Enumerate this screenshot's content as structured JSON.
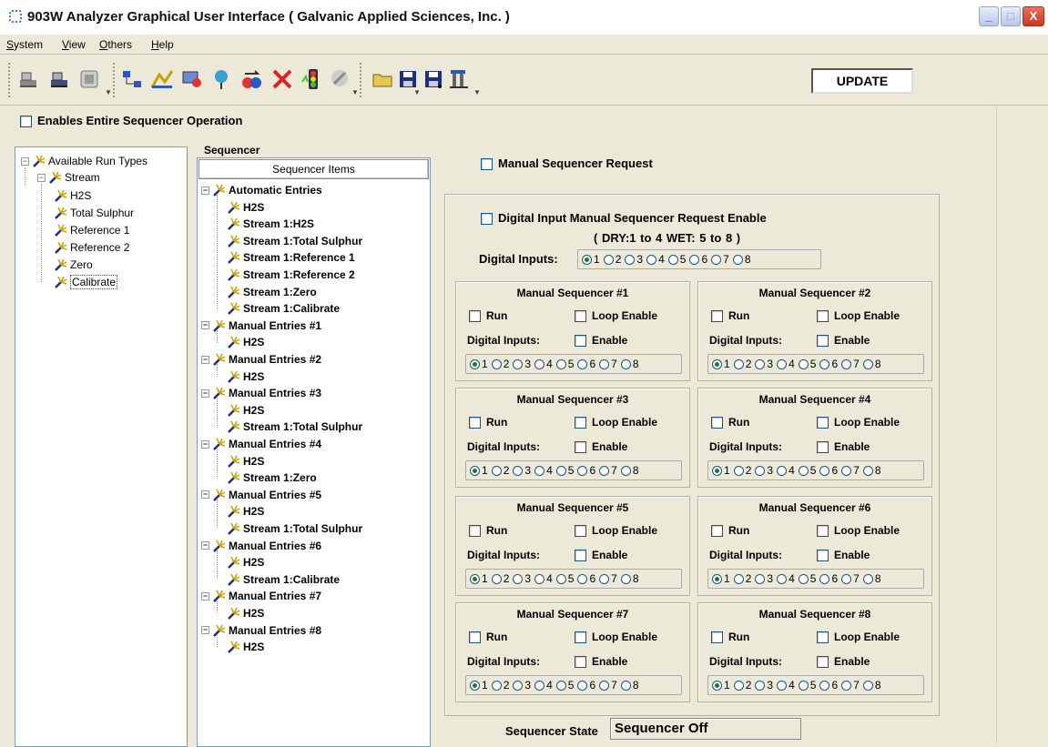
{
  "window": {
    "title": "903W Analyzer Graphical User Interface ( Galvanic Applied Sciences, Inc. )",
    "minimize": "_",
    "maximize": "□",
    "close": "X"
  },
  "menu": {
    "items": [
      "System",
      "View",
      "Others",
      "Help"
    ]
  },
  "toolbar": {
    "update_label": "UPDATE"
  },
  "enable_sequencer": "Enables Entire Sequencer Operation",
  "run_types": {
    "root": "Available Run Types",
    "stream": "Stream",
    "items": [
      "H2S",
      "Total Sulphur",
      "Reference 1",
      "Reference 2",
      "Zero",
      "Calibrate"
    ],
    "selected": "Calibrate"
  },
  "sequencer": {
    "legend": "Sequencer",
    "header": "Sequencer Items",
    "groups": [
      {
        "label": "Automatic Entries",
        "children": [
          "H2S",
          "Stream 1:H2S",
          "Stream 1:Total Sulphur",
          "Stream 1:Reference 1",
          "Stream 1:Reference 2",
          "Stream 1:Zero",
          "Stream 1:Calibrate"
        ]
      },
      {
        "label": "Manual Entries #1",
        "children": [
          "H2S"
        ]
      },
      {
        "label": "Manual Entries #2",
        "children": [
          "H2S"
        ]
      },
      {
        "label": "Manual Entries #3",
        "children": [
          "H2S",
          "Stream 1:Total Sulphur"
        ]
      },
      {
        "label": "Manual Entries #4",
        "children": [
          "H2S",
          "Stream 1:Zero"
        ]
      },
      {
        "label": "Manual Entries #5",
        "children": [
          "H2S",
          "Stream 1:Total Sulphur"
        ]
      },
      {
        "label": "Manual Entries #6",
        "children": [
          "H2S",
          "Stream 1:Calibrate"
        ]
      },
      {
        "label": "Manual Entries #7",
        "children": [
          "H2S"
        ]
      },
      {
        "label": "Manual Entries #8",
        "children": [
          "H2S"
        ]
      }
    ]
  },
  "manual_request": "Manual Sequencer Request",
  "digital_input": {
    "enable_label": "Digital Input Manual Sequencer Request Enable",
    "dry_wet": "( DRY:1 to 4     WET: 5 to 8 )",
    "inputs_label": "Digital Inputs:",
    "options": [
      "1",
      "2",
      "3",
      "4",
      "5",
      "6",
      "7",
      "8"
    ],
    "selected": "1"
  },
  "manual_sequencers": [
    {
      "title": "Manual Sequencer #1",
      "run": "Run",
      "loop": "Loop Enable",
      "di_label": "Digital Inputs:",
      "enable": "Enable",
      "selected": "1"
    },
    {
      "title": "Manual Sequencer #2",
      "run": "Run",
      "loop": "Loop Enable",
      "di_label": "Digital Inputs:",
      "enable": "Enable",
      "selected": "1"
    },
    {
      "title": "Manual Sequencer #3",
      "run": "Run",
      "loop": "Loop Enable",
      "di_label": "Digital Inputs:",
      "enable": "Enable",
      "selected": "1"
    },
    {
      "title": "Manual Sequencer #4",
      "run": "Run",
      "loop": "Loop Enable",
      "di_label": "Digital Inputs:",
      "enable": "Enable",
      "selected": "1"
    },
    {
      "title": "Manual Sequencer #5",
      "run": "Run",
      "loop": "Loop Enable",
      "di_label": "Digital Inputs:",
      "enable": "Enable",
      "selected": "1"
    },
    {
      "title": "Manual Sequencer #6",
      "run": "Run",
      "loop": "Loop Enable",
      "di_label": "Digital Inputs:",
      "enable": "Enable",
      "selected": "1"
    },
    {
      "title": "Manual Sequencer #7",
      "run": "Run",
      "loop": "Loop Enable",
      "di_label": "Digital Inputs:",
      "enable": "Enable",
      "selected": "1"
    },
    {
      "title": "Manual Sequencer #8",
      "run": "Run",
      "loop": "Loop Enable",
      "di_label": "Digital Inputs:",
      "enable": "Enable",
      "selected": "1"
    }
  ],
  "sequencer_state": {
    "label": "Sequencer State",
    "value": "Sequencer Off"
  },
  "colors": {
    "face": "#ece9d8",
    "accent_blue": "#2b58c8",
    "radio_dot": "#1e7b1e"
  }
}
